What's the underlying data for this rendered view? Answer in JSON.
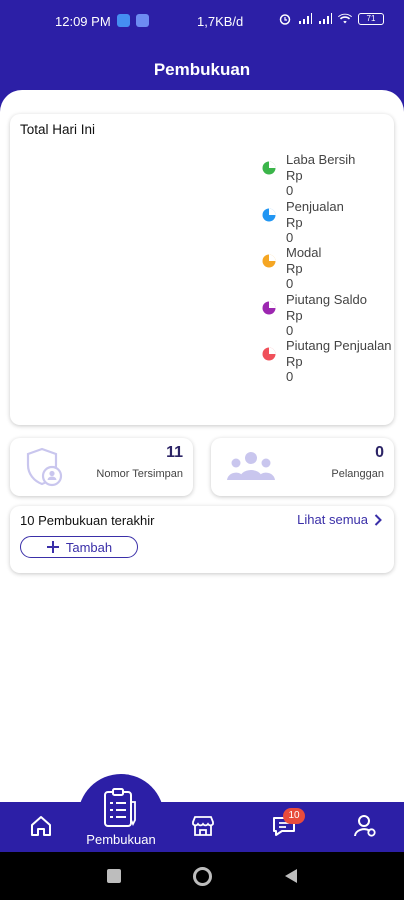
{
  "status_bar": {
    "time": "12:09 PM",
    "network_speed": "1,7KB/d",
    "battery": "71"
  },
  "header": {
    "title": "Pembukuan"
  },
  "summary": {
    "title": "Total Hari Ini",
    "legend": [
      {
        "label": "Laba Bersih",
        "value": "Rp 0",
        "color": "#3bb54a"
      },
      {
        "label": "Penjualan",
        "value": "Rp 0",
        "color": "#2196f3"
      },
      {
        "label": "Modal",
        "value": "Rp 0",
        "color": "#f5a623"
      },
      {
        "label": "Piutang Saldo",
        "value": "Rp 0",
        "color": "#9c27b0"
      },
      {
        "label": "Piutang Penjualan",
        "value": "Rp 0",
        "color": "#f0505a"
      }
    ]
  },
  "stats": {
    "saved_numbers": {
      "count": "11",
      "label": "Nomor Tersimpan",
      "icon": "shield-user-icon"
    },
    "customers": {
      "count": "0",
      "label": "Pelanggan",
      "icon": "group-icon"
    }
  },
  "recent": {
    "title": "10 Pembukuan terakhir",
    "see_all": "Lihat semua",
    "add_label": "Tambah"
  },
  "bottom_nav": {
    "active_label": "Pembukuan",
    "chat_badge": "10",
    "items": [
      "home-icon",
      "ledger-icon",
      "store-icon",
      "chat-icon",
      "profile-icon"
    ]
  },
  "colors": {
    "primary": "#2c1fa6",
    "accent_text": "#3a2fa8",
    "badge": "#e84b3c"
  }
}
